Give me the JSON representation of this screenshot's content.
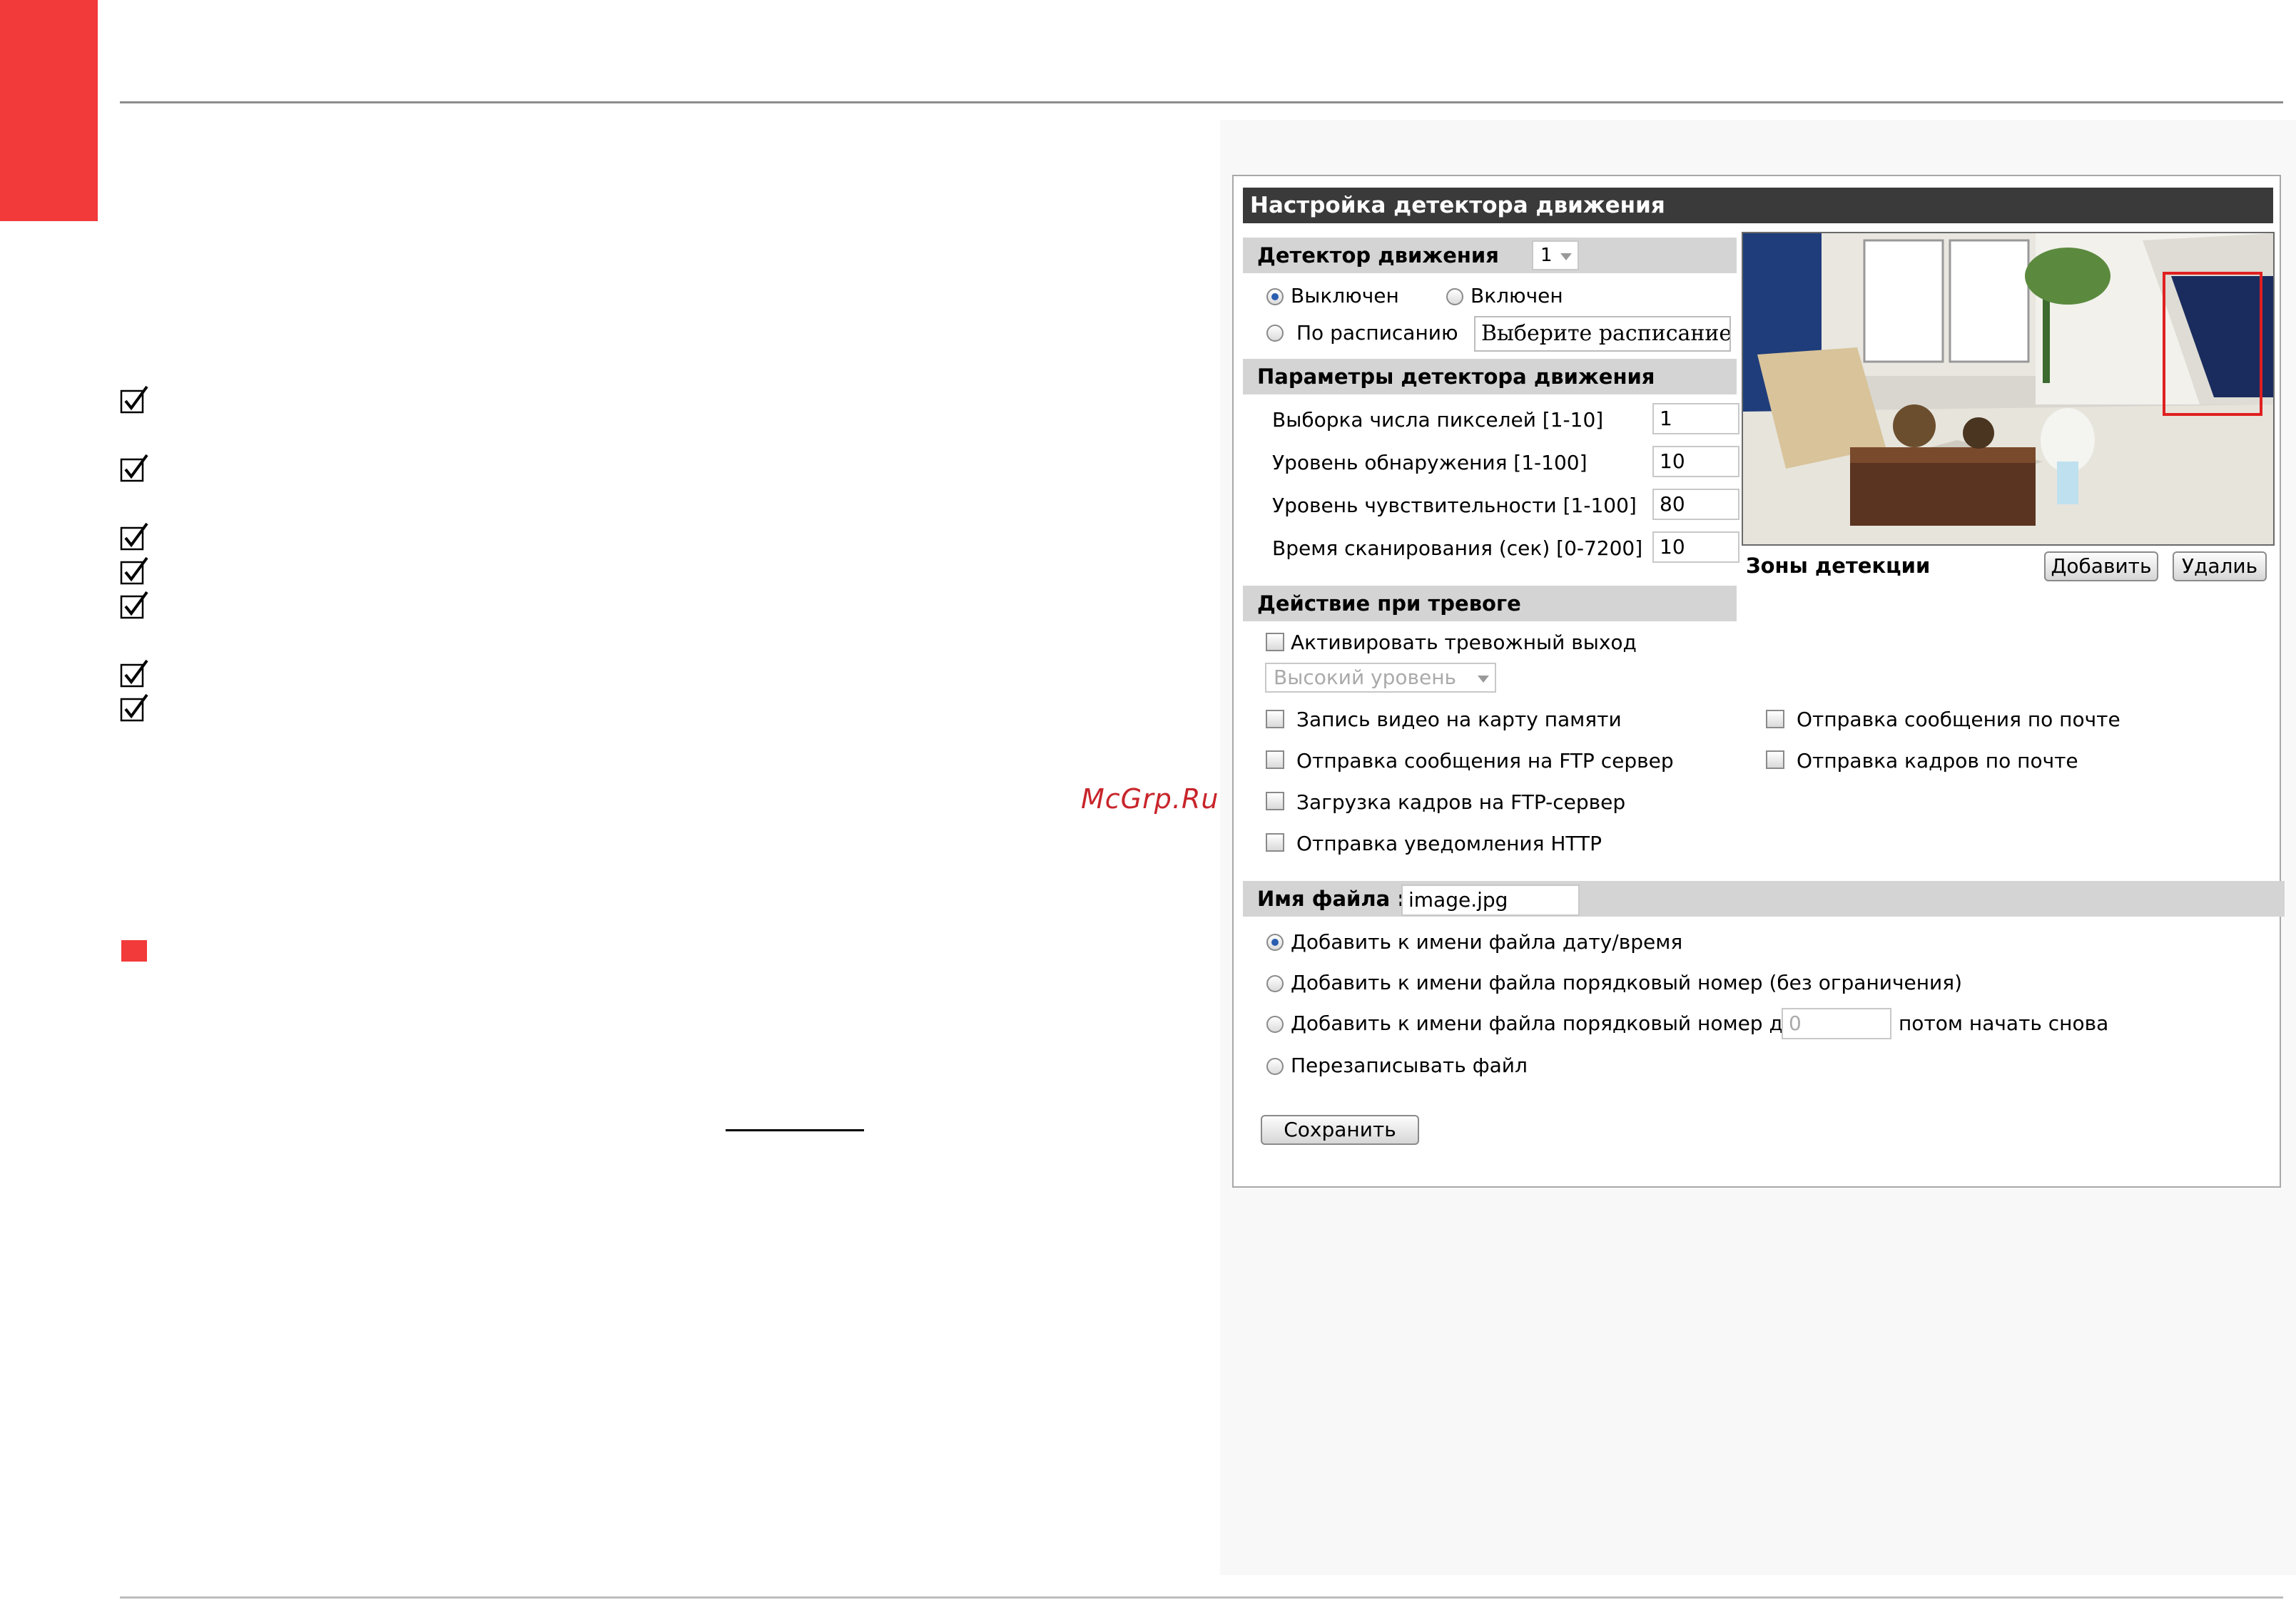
{
  "watermark": "McGrp.Ru",
  "window": {
    "title": "Настройка детектора движения",
    "detector": {
      "label": "Детектор движения",
      "selected": "1",
      "off_label": "Выключен",
      "on_label": "Включен",
      "schedule_label": "По расписанию",
      "schedule_button": "Выберите расписание..."
    },
    "params": {
      "label": "Параметры детектора движения",
      "rows": [
        {
          "label": "Выборка числа пикселей [1-10]",
          "value": "1"
        },
        {
          "label": "Уровень обнаружения [1-100]",
          "value": "10"
        },
        {
          "label": "Уровень чувствительности [1-100]",
          "value": "80"
        },
        {
          "label": "Время сканирования (сек) [0-7200]",
          "value": "10"
        }
      ]
    },
    "zones": {
      "label": "Зоны детекции",
      "add_button": "Добавить",
      "delete_button": "Удалиь"
    },
    "alarm": {
      "label": "Действие при тревоге",
      "activate_output": "Активировать тревожный выход",
      "level_select": "Высокий уровень",
      "left_options": [
        "Запись видео на карту памяти",
        "Отправка сообщения на FTP сервер",
        "Загрузка кадров на FTP-сервер",
        "Отправка уведомления HTTP"
      ],
      "right_options": [
        "Отправка сообщения по почте",
        "Отправка кадров по почте"
      ]
    },
    "file": {
      "label": "Имя файла :",
      "value": "image.jpg",
      "opt1": "Добавить к имени файла дату/время",
      "opt2": "Добавить к имени файла порядковый номер (без ограничения)",
      "opt3_pre": "Добавить к имени файла порядковый номер до",
      "opt3_value": "0",
      "opt3_post": "потом начать снова",
      "opt4": "Перезаписывать файл"
    },
    "save_button": "Сохранить"
  },
  "colors": {
    "accent_red": "#f23a3a",
    "title_bar": "#3a3a3a",
    "section_bg": "#d4d4d4",
    "zone_border": "#e02020"
  }
}
